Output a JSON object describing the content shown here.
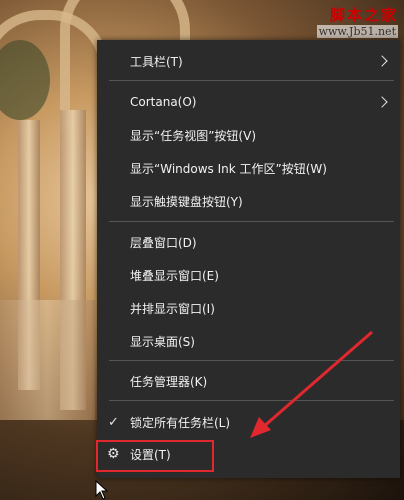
{
  "watermark": {
    "title": "脚本之家",
    "url": "www.Jb51.net"
  },
  "menu": {
    "toolbars_label": "工具栏(T)",
    "cortana_label": "Cortana(O)",
    "task_view_label": "显示“任务视图”按钮(V)",
    "windows_ink_label": "显示“Windows Ink 工作区”按钮(W)",
    "touch_keyboard_label": "显示触摸键盘按钮(Y)",
    "cascade_label": "层叠窗口(D)",
    "stacked_label": "堆叠显示窗口(E)",
    "side_by_side_label": "并排显示窗口(I)",
    "show_desktop_label": "显示桌面(S)",
    "task_manager_label": "任务管理器(K)",
    "lock_taskbars_label": "锁定所有任务栏(L)",
    "settings_label": "设置(T)"
  },
  "icons": {
    "submenu": "chevron-right-icon",
    "checked": "checkmark-icon",
    "settings": "gear-icon"
  },
  "colors": {
    "menu_background": "#2b2b2b",
    "menu_text": "#f2f2f2",
    "annotation": "#e0282e"
  }
}
